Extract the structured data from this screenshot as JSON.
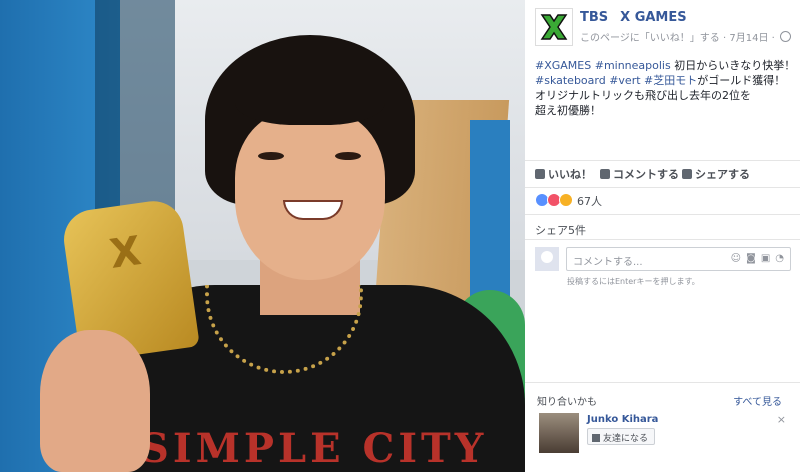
{
  "post": {
    "page_name_part1": "TBS",
    "page_name_part2": "X GAMES",
    "meta_like": "このページに「いいね！」する",
    "meta_sep": " · ",
    "meta_date": "7月14日",
    "text_line1_tags": "#XGAMES #minneapolis",
    "text_line1_rest": " 初日からいきなり快挙！",
    "text_line2_tags": "#skateboard #vert #芝田モト",
    "text_line2_rest": "がゴールド獲得！",
    "text_line3": "オリジナルトリックも飛び出し去年の2位を",
    "text_line4": "超え初優勝！"
  },
  "actions": {
    "like": "いいね！",
    "comment": "コメントする",
    "share": "シェアする"
  },
  "reactions": {
    "count": "67人"
  },
  "shares": "シェア5件",
  "comment": {
    "placeholder": "コメントする...",
    "hint": "投稿するにはEnterキーを押します。"
  },
  "pymk": {
    "title": "知り合いかも",
    "see_all": "すべて見る",
    "friend_name": "Junko Kihara",
    "add_button": "友達になる",
    "close": "×"
  },
  "photo": {
    "shirt_text": "SIMPLE CITY"
  },
  "colors": {
    "link": "#365899",
    "xgames_green": "#3aa935",
    "text": "#1d2129",
    "muted": "#90949c"
  }
}
